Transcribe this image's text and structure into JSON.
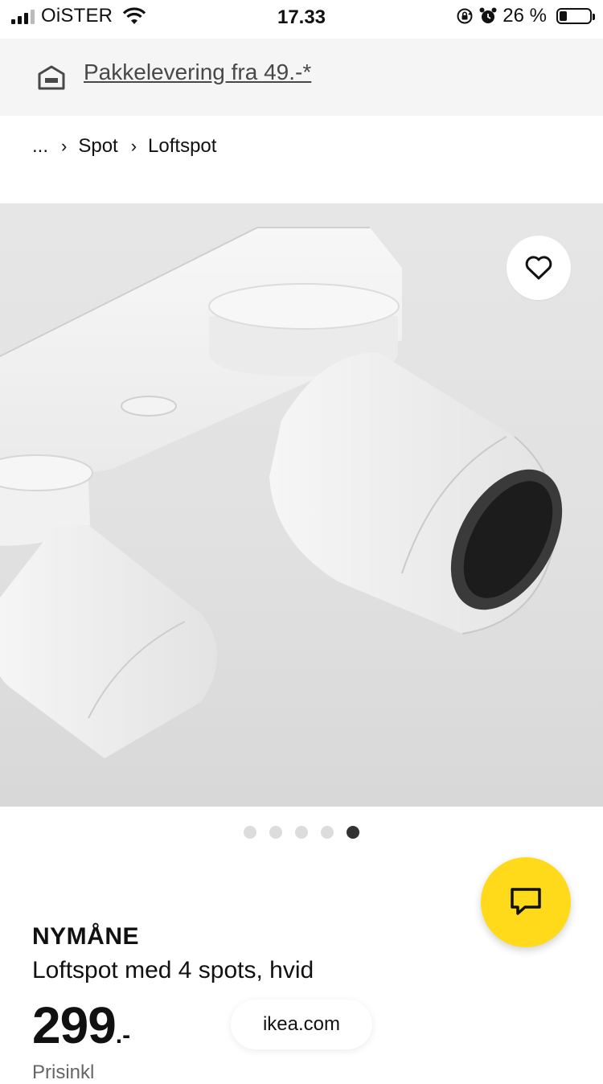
{
  "status_bar": {
    "carrier": "OiSTER",
    "time": "17.33",
    "battery_text": "26 %",
    "battery_level": 0.26
  },
  "banner": {
    "text": "Pakkelevering fra 49.-*",
    "icon": "delivery-truck-icon"
  },
  "breadcrumb": {
    "ellipsis": "...",
    "items": [
      "Spot",
      "Loftspot"
    ]
  },
  "gallery": {
    "image_count": 5,
    "active_index": 4
  },
  "product": {
    "name": "NYMÅNE",
    "description": "Loftspot med 4 spots, hvid",
    "price": "299",
    "price_suffix": ".-",
    "cut_text": "Prisinkl"
  },
  "browser": {
    "domain": "ikea.com"
  },
  "colors": {
    "chat_button": "#ffda1a",
    "banner_bg": "#f5f5f5",
    "active_dot": "#333333",
    "inactive_dot": "#dcdcdc"
  }
}
